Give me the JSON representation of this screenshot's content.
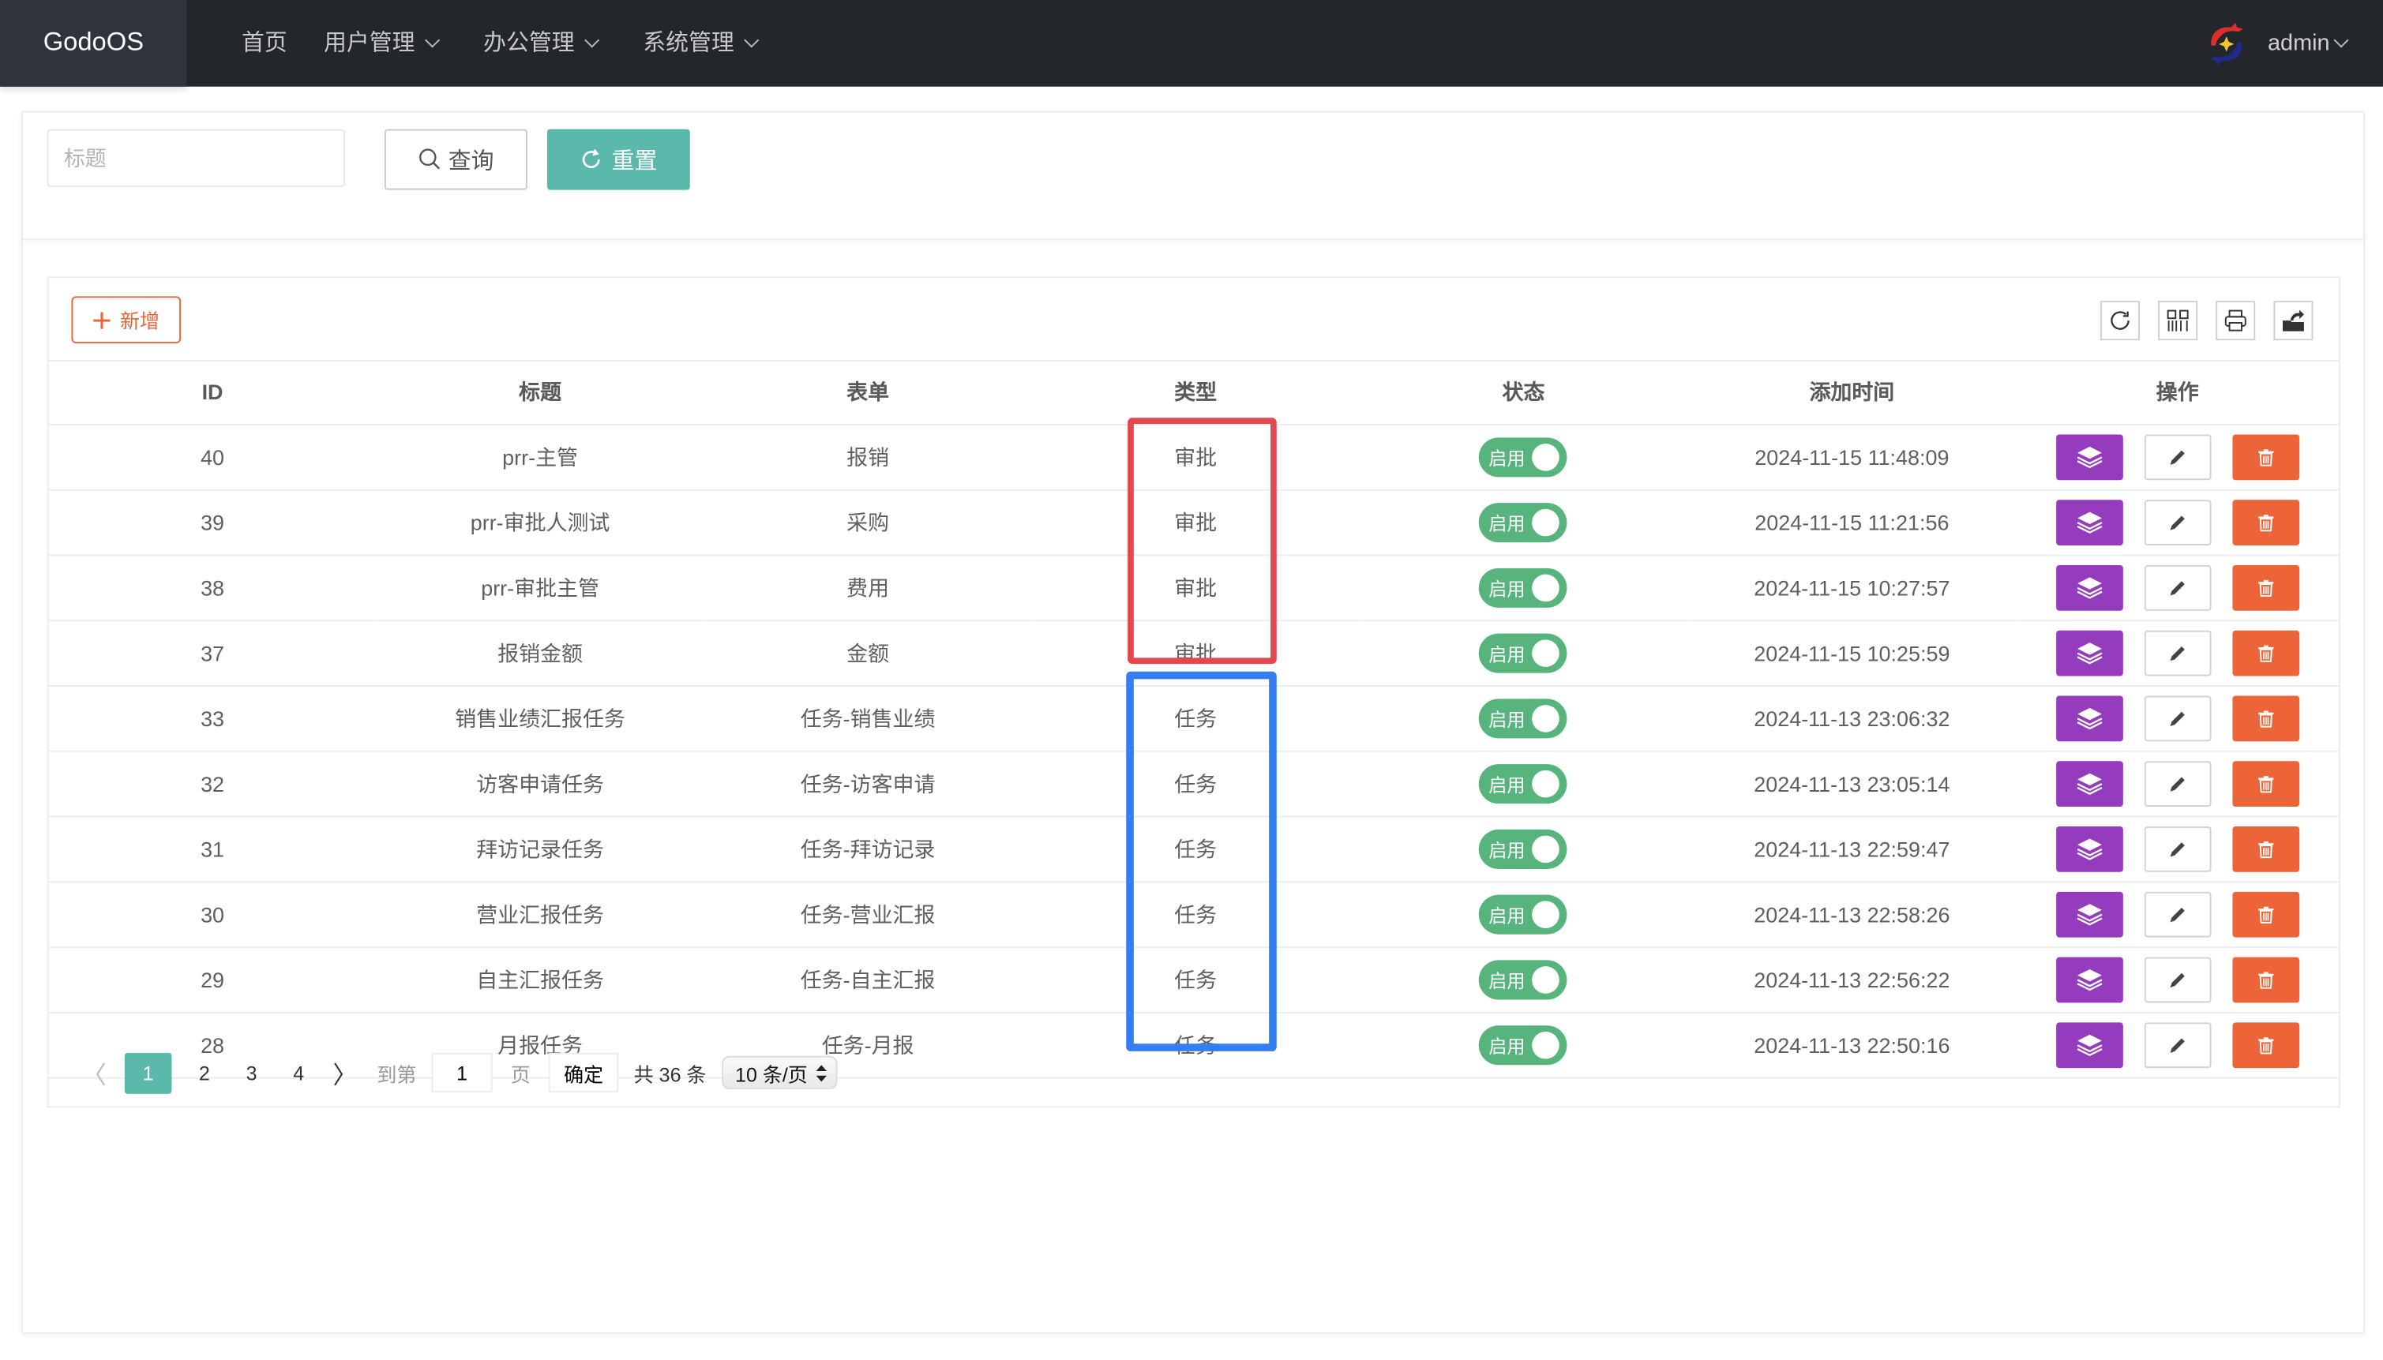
{
  "header": {
    "logo": "GodoOS",
    "nav": [
      {
        "label": "首页",
        "dropdown": false
      },
      {
        "label": "用户管理",
        "dropdown": true
      },
      {
        "label": "办公管理",
        "dropdown": true
      },
      {
        "label": "系统管理",
        "dropdown": true
      }
    ],
    "user": {
      "name": "admin",
      "avatar_icon": "dragon-logo-icon"
    }
  },
  "search": {
    "title_placeholder": "标题",
    "title_value": "",
    "query_label": "查询",
    "reset_label": "重置"
  },
  "toolbar": {
    "add_label": "新增",
    "tools": [
      "refresh-icon",
      "columns-icon",
      "print-icon",
      "export-icon"
    ]
  },
  "table": {
    "columns": [
      "ID",
      "标题",
      "表单",
      "类型",
      "状态",
      "添加时间",
      "操作"
    ],
    "rows": [
      {
        "id": "40",
        "title": "prr-主管",
        "form": "报销",
        "type": "审批",
        "status": "启用",
        "time": "2024-11-15 11:48:09"
      },
      {
        "id": "39",
        "title": "prr-审批人测试",
        "form": "采购",
        "type": "审批",
        "status": "启用",
        "time": "2024-11-15 11:21:56"
      },
      {
        "id": "38",
        "title": "prr-审批主管",
        "form": "费用",
        "type": "审批",
        "status": "启用",
        "time": "2024-11-15 10:27:57"
      },
      {
        "id": "37",
        "title": "报销金额",
        "form": "金额",
        "type": "审批",
        "status": "启用",
        "time": "2024-11-15 10:25:59"
      },
      {
        "id": "33",
        "title": "销售业绩汇报任务",
        "form": "任务-销售业绩",
        "type": "任务",
        "status": "启用",
        "time": "2024-11-13 23:06:32"
      },
      {
        "id": "32",
        "title": "访客申请任务",
        "form": "任务-访客申请",
        "type": "任务",
        "status": "启用",
        "time": "2024-11-13 23:05:14"
      },
      {
        "id": "31",
        "title": "拜访记录任务",
        "form": "任务-拜访记录",
        "type": "任务",
        "status": "启用",
        "time": "2024-11-13 22:59:47"
      },
      {
        "id": "30",
        "title": "营业汇报任务",
        "form": "任务-营业汇报",
        "type": "任务",
        "status": "启用",
        "time": "2024-11-13 22:58:26"
      },
      {
        "id": "29",
        "title": "自主汇报任务",
        "form": "任务-自主汇报",
        "type": "任务",
        "status": "启用",
        "time": "2024-11-13 22:56:22"
      },
      {
        "id": "28",
        "title": "月报任务",
        "form": "任务-月报",
        "type": "任务",
        "status": "启用",
        "time": "2024-11-13 22:50:16"
      }
    ]
  },
  "pagination": {
    "pages": [
      "1",
      "2",
      "3",
      "4"
    ],
    "current": "1",
    "goto_label": "到第",
    "goto_value": "1",
    "page_unit": "页",
    "confirm_label": "确定",
    "total_label": "共 36 条",
    "page_size": "10 条/页"
  },
  "annotations": [
    {
      "color": "#e4484e",
      "covers_type": "审批"
    },
    {
      "color": "#347ef2",
      "covers_type": "任务"
    }
  ],
  "colors": {
    "header_bg": "#23262b",
    "primary_teal": "#5bb9ab",
    "add_orange": "#e9673a",
    "switch_green": "#56b47c",
    "view_purple": "#953bbd",
    "delete_orange": "#ec6437"
  }
}
